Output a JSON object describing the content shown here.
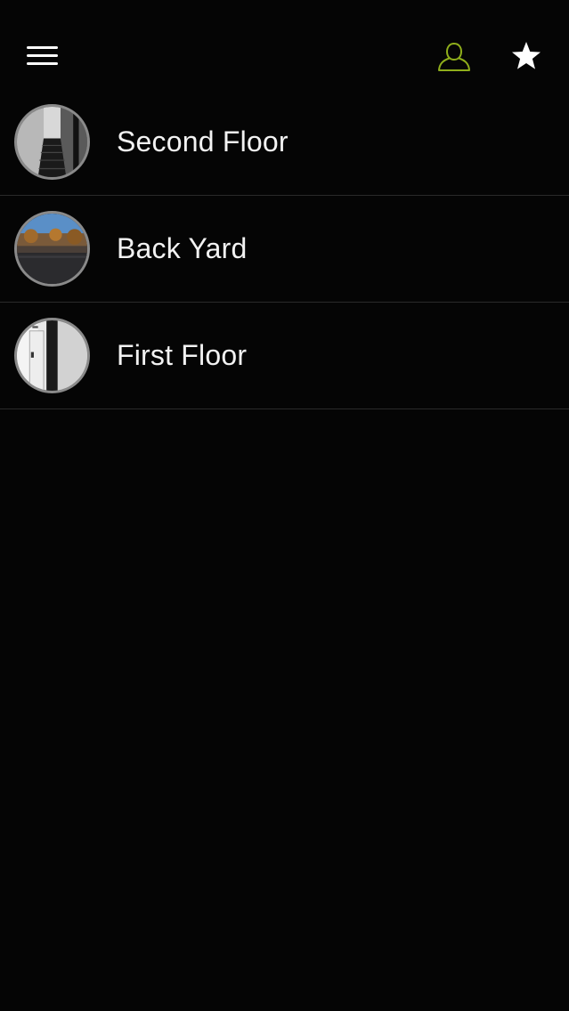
{
  "header": {
    "menu_icon": "hamburger-menu-icon",
    "account_icon": "person-outline-icon",
    "favorites_icon": "star-icon",
    "account_color": "#8fae1b"
  },
  "cameras": [
    {
      "label": "Second Floor",
      "thumbnail": "stairwell-scene"
    },
    {
      "label": "Back Yard",
      "thumbnail": "backyard-scene"
    },
    {
      "label": "First Floor",
      "thumbnail": "hallway-door-scene"
    }
  ]
}
